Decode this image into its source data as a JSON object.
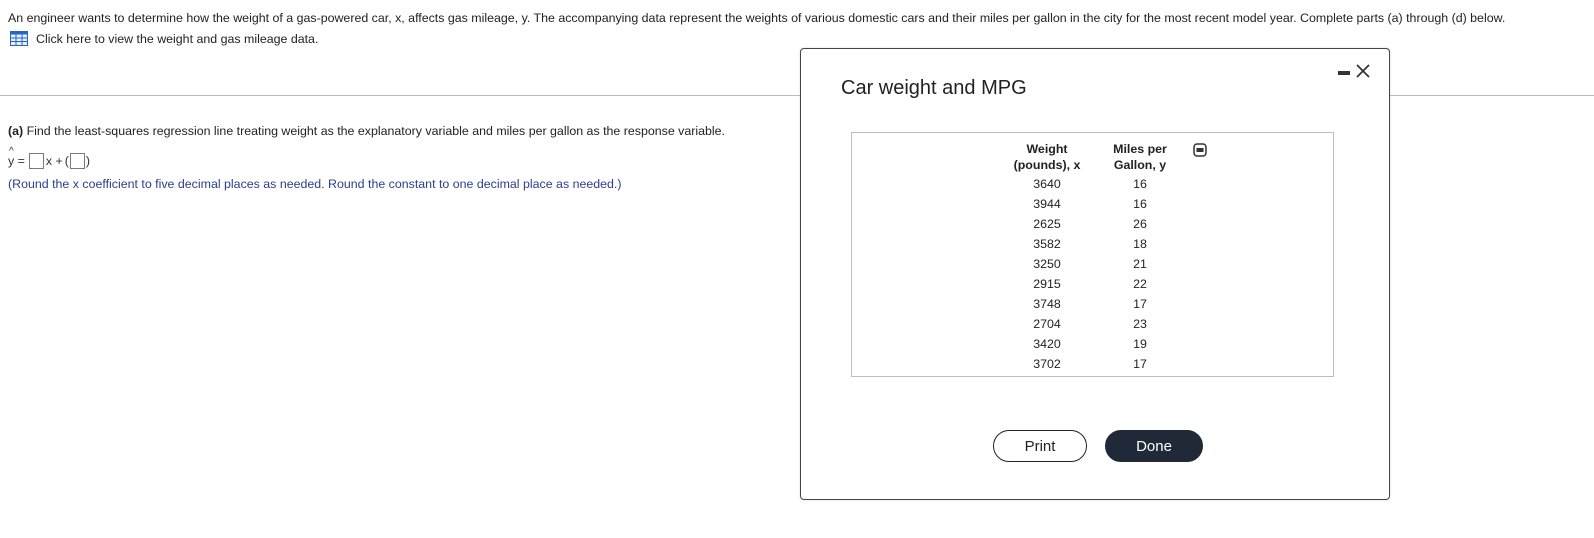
{
  "problem": {
    "statement": "An engineer wants to determine how the weight of a gas-powered car, x, affects gas mileage, y. The accompanying data represent the weights of various domestic cars and their miles per gallon in the city for the most recent model year. Complete parts (a) through (d) below.",
    "data_link": "Click here to view the weight and gas mileage data.",
    "data_link_icon": "table-grid-icon"
  },
  "part_a": {
    "label": "(a)",
    "question": " Find the least-squares regression line treating weight as the explanatory variable and miles per gallon as the response variable.",
    "eq_lhs": "y =",
    "eq_x": "x +",
    "eq_open": "(",
    "eq_close": ")",
    "slope_value": "",
    "intercept_value": "",
    "note": "(Round the x coefficient to five decimal places as needed. Round the constant to one decimal place as needed.)"
  },
  "dialog": {
    "title": "Car weight and MPG",
    "headers": {
      "weight_line1": "Weight",
      "weight_line2": "(pounds), x",
      "mpg_line1": "Miles per",
      "mpg_line2": "Gallon, y"
    },
    "rows": [
      {
        "weight": "3640",
        "mpg": "16"
      },
      {
        "weight": "3944",
        "mpg": "16"
      },
      {
        "weight": "2625",
        "mpg": "26"
      },
      {
        "weight": "3582",
        "mpg": "18"
      },
      {
        "weight": "3250",
        "mpg": "21"
      },
      {
        "weight": "2915",
        "mpg": "22"
      },
      {
        "weight": "3748",
        "mpg": "17"
      },
      {
        "weight": "2704",
        "mpg": "23"
      },
      {
        "weight": "3420",
        "mpg": "19"
      },
      {
        "weight": "3702",
        "mpg": "17"
      }
    ],
    "print_label": "Print",
    "done_label": "Done",
    "icons": [
      "minimize-icon",
      "close-icon",
      "copy-icon"
    ]
  },
  "colors": {
    "note_blue": "#2a3f8f",
    "done_bg": "#1f2937",
    "link_icon_blue": "#2563c9"
  }
}
